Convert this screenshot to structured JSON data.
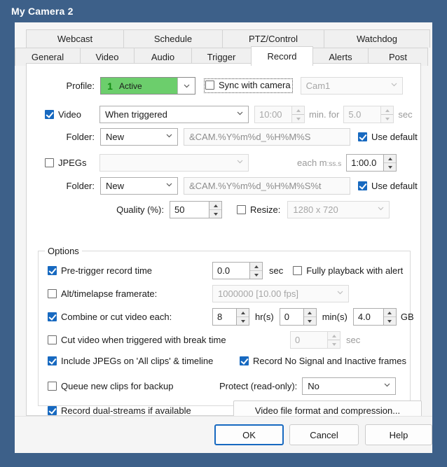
{
  "window": {
    "title": "My Camera 2"
  },
  "tabs": {
    "row1": [
      {
        "label": "Webcast"
      },
      {
        "label": "Schedule"
      },
      {
        "label": "PTZ/Control"
      },
      {
        "label": "Watchdog"
      }
    ],
    "row2": [
      {
        "label": "General"
      },
      {
        "label": "Video"
      },
      {
        "label": "Audio"
      },
      {
        "label": "Trigger"
      },
      {
        "label": "Record"
      },
      {
        "label": "Alerts"
      },
      {
        "label": "Post"
      }
    ],
    "selected": "Record"
  },
  "record": {
    "profile_label": "Profile:",
    "profile_number": "1",
    "profile_value": "Active",
    "sync_with_camera_label": "Sync with camera",
    "sync_with_camera_checked": false,
    "camera_value": "Cam1",
    "video_label": "Video",
    "video_checked": true,
    "video_mode": "When triggered",
    "video_time": "10:00",
    "video_min_for_label": "min. for",
    "video_duration": "5.0",
    "video_sec_label": "sec",
    "video_folder_label": "Folder:",
    "video_folder_mode": "New",
    "video_folder_mask": "&CAM.%Y%m%d_%H%M%S",
    "video_use_default_label": "Use default",
    "video_use_default_checked": true,
    "jpegs_label": "JPEGs",
    "jpegs_checked": false,
    "jpegs_mode": "",
    "jpegs_each_label": "each m:ss.s",
    "jpegs_each_label_main": "each m",
    "jpegs_each_label_sub": ":ss.s",
    "jpegs_interval": "1:00.0",
    "jpegs_folder_label": "Folder:",
    "jpegs_folder_mode": "New",
    "jpegs_folder_mask": "&CAM.%Y%m%d_%H%M%S%t",
    "jpegs_use_default_label": "Use default",
    "jpegs_use_default_checked": true,
    "quality_label": "Quality (%):",
    "quality_value": "50",
    "resize_label": "Resize:",
    "resize_checked": false,
    "resize_value": "1280 x 720"
  },
  "options": {
    "legend": "Options",
    "pretrigger_label": "Pre-trigger record time",
    "pretrigger_checked": true,
    "pretrigger_value": "0.0",
    "pretrigger_unit": "sec",
    "fully_playback_label": "Fully playback with alert",
    "fully_playback_checked": false,
    "alt_framerate_label": "Alt/timelapse framerate:",
    "alt_framerate_checked": false,
    "alt_framerate_value": "1000000 [10.00 fps]",
    "combine_label": "Combine or cut video each:",
    "combine_checked": true,
    "combine_hours": "8",
    "combine_hours_unit": "hr(s)",
    "combine_mins": "0",
    "combine_mins_unit": "min(s)",
    "combine_size": "4.0",
    "combine_size_unit": "GB",
    "cut_break_label": "Cut video when triggered with break time",
    "cut_break_checked": false,
    "cut_break_value": "0",
    "cut_break_unit": "sec",
    "include_jpegs_label": "Include JPEGs on 'All clips' & timeline",
    "include_jpegs_checked": true,
    "record_nosignal_label": "Record No Signal and Inactive frames",
    "record_nosignal_checked": true,
    "queue_backup_label": "Queue new clips for backup",
    "queue_backup_checked": false,
    "protect_label": "Protect (read-only):",
    "protect_value": "No",
    "dual_streams_label": "Record dual-streams if available",
    "dual_streams_checked": true,
    "video_format_button": "Video file format and compression..."
  },
  "buttons": {
    "ok": "OK",
    "cancel": "Cancel",
    "help": "Help"
  },
  "colors": {
    "titlebar": "#3d6089",
    "accent_checkbox": "#1769c0",
    "profile_green": "#6cce6c",
    "focus_border": "#1769c0"
  }
}
